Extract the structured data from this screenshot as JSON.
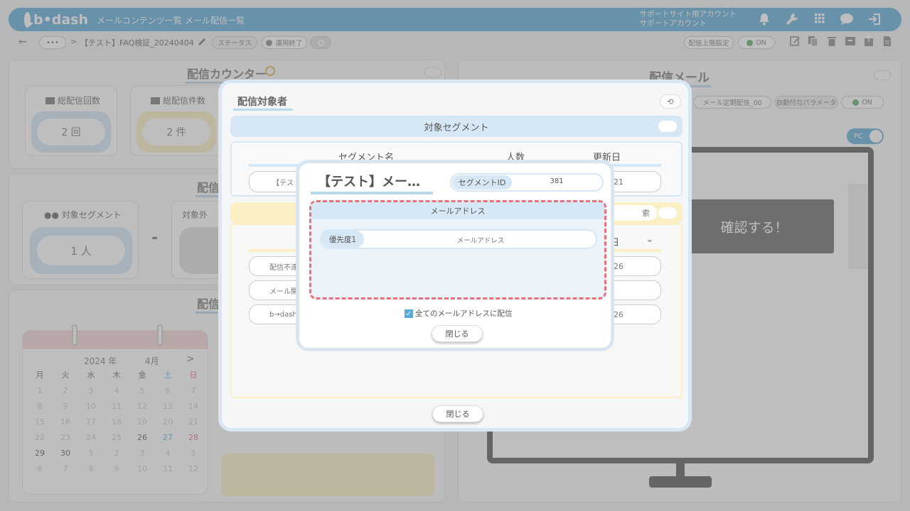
{
  "header": {
    "logo": "b•dash",
    "nav": [
      "メールコンテンツ一覧",
      "メール配信一覧"
    ],
    "account_line1": "サポートサイト用アカウント",
    "account_line2": "サポートアカウント",
    "icons": [
      "bell-icon",
      "wrench-icon",
      "grid-icon",
      "chat-icon",
      "logout-icon"
    ]
  },
  "breadcrumb": {
    "back": "←",
    "more": "•••",
    "sep": ">",
    "title": "【テスト】FAQ検証_20240404",
    "status_label": "ステータス",
    "status_value": "運用終了",
    "limit_label": "配信上限設定",
    "toggle_on": "ON"
  },
  "left": {
    "counter_title": "配信カウンター",
    "total_count_label": "総配信回数",
    "total_count_value": "2 回",
    "total_items_label": "総配信件数",
    "total_items_value": "2 件",
    "delivery_title": "配信",
    "segment_label": "対象セグメント",
    "segment_value": "1 人",
    "exclude_label": "対象外",
    "minus": "-",
    "schedule_title": "配信",
    "calendar": {
      "year": "2024",
      "year_suffix": "年",
      "month": "4月",
      "next": ">",
      "weekdays": [
        "月",
        "火",
        "水",
        "木",
        "金",
        "土",
        "日"
      ],
      "weeks": [
        [
          "1",
          "2",
          "3",
          "4",
          "5",
          "6",
          "7"
        ],
        [
          "8",
          "9",
          "10",
          "11",
          "12",
          "13",
          "14"
        ],
        [
          "15",
          "16",
          "17",
          "18",
          "19",
          "20",
          "21"
        ],
        [
          "22",
          "23",
          "24",
          "25",
          "26",
          "27",
          "28"
        ],
        [
          "29",
          "30",
          "1",
          "2",
          "3",
          "4",
          "5"
        ],
        [
          "6",
          "7",
          "8",
          "9",
          "10",
          "11",
          "12"
        ]
      ]
    }
  },
  "right": {
    "mail_title": "配信メール",
    "mail_name": "メール定期配信_00",
    "auto_param_label": "自動付与パラメータ",
    "toggle_on": "ON",
    "pc_label": "PC",
    "confirm_text": "確認する！"
  },
  "modal1": {
    "title": "配信対象者",
    "segment_header": "対象セグメント",
    "columns": [
      "セグメント名",
      "人数",
      "更新日"
    ],
    "row_name": "【テスト",
    "row_date": "21",
    "lower_rows": [
      "配信不達",
      "メール開",
      "b→dash"
    ],
    "lower_dates": [
      "26",
      "",
      "26"
    ],
    "lower_date_header": "日",
    "search_suffix": "索",
    "close": "閉じる"
  },
  "modal2": {
    "title": "【テスト】メー…",
    "segment_id_label": "セグメントID",
    "segment_id_value": "381",
    "section_header": "メールアドレス",
    "priority_label": "優先度1",
    "priority_value": "メールアドレス",
    "checkbox_label": "全てのメールアドレスに配信",
    "checkbox_checked": true,
    "close": "閉じる"
  },
  "colors": {
    "brand": "#5aaad8",
    "highlight": "#e8707a",
    "blue_soft": "#d6e8f5",
    "yellow_soft": "#fbefc4"
  }
}
